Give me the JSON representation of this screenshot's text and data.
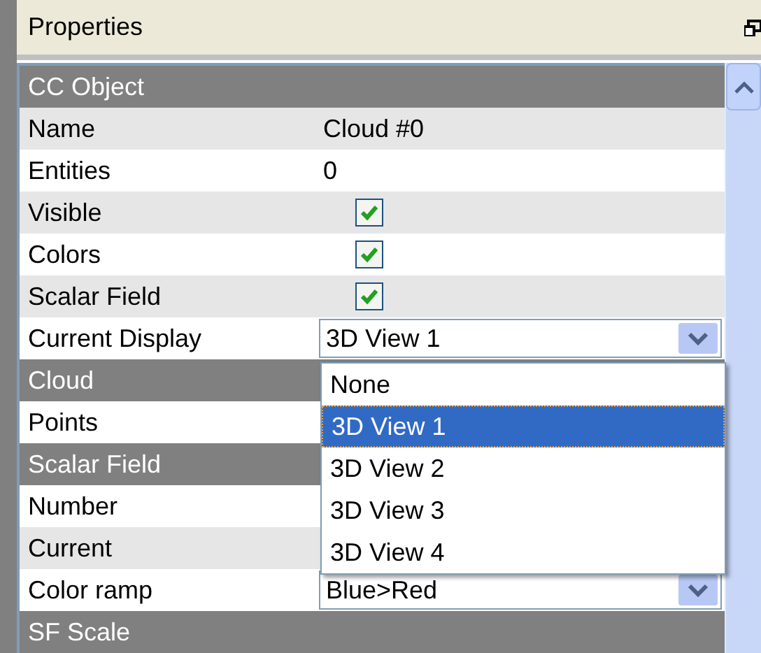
{
  "panel": {
    "title": "Properties"
  },
  "rows": [
    {
      "kind": "section",
      "label": "CC Object"
    },
    {
      "kind": "text",
      "label": "Name",
      "value": "Cloud #0"
    },
    {
      "kind": "text",
      "label": "Entities",
      "value": "0"
    },
    {
      "kind": "check",
      "label": "Visible",
      "checked": true
    },
    {
      "kind": "check",
      "label": "Colors",
      "checked": true
    },
    {
      "kind": "check",
      "label": "Scalar Field",
      "checked": true
    },
    {
      "kind": "combo",
      "label": "Current Display",
      "value": "3D View 1"
    },
    {
      "kind": "section",
      "label": "Cloud"
    },
    {
      "kind": "text",
      "label": "Points"
    },
    {
      "kind": "section",
      "label": "Scalar Field"
    },
    {
      "kind": "text",
      "label": "Number"
    },
    {
      "kind": "text",
      "label": "Current"
    },
    {
      "kind": "combo",
      "label": "Color ramp",
      "value": "Blue>Red"
    },
    {
      "kind": "section",
      "label": "SF Scale"
    }
  ],
  "dropdown": {
    "options": [
      {
        "label": "None",
        "selected": false
      },
      {
        "label": "3D View 1",
        "selected": true
      },
      {
        "label": "3D View 2",
        "selected": false
      },
      {
        "label": "3D View 3",
        "selected": false
      },
      {
        "label": "3D View 4",
        "selected": false
      }
    ]
  }
}
